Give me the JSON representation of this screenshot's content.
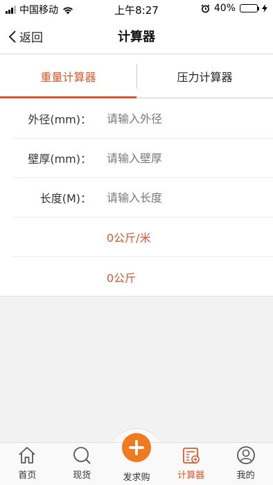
{
  "status_bar": {
    "carrier": "中国移动",
    "time": "上午8:27",
    "battery": "40%",
    "battery_level": 0.4,
    "battery_color": "#4cd964"
  },
  "nav": {
    "back_label": "返回",
    "title": "计算器",
    "back_icon": "chevron-left-icon"
  },
  "tabs": [
    {
      "label": "重量计算器",
      "active": true
    },
    {
      "label": "压力计算器",
      "active": false
    }
  ],
  "form": {
    "outer_diameter": {
      "label": "外径(mm)：",
      "placeholder": "请输入外径",
      "value": ""
    },
    "wall_thickness": {
      "label": "壁厚(mm)：",
      "placeholder": "请输入壁厚",
      "value": ""
    },
    "length": {
      "label": "长度(M)：",
      "placeholder": "请输入长度",
      "value": ""
    },
    "result_per_meter": "0公斤/米",
    "result_total": "0公斤"
  },
  "bottom_nav": {
    "items": [
      {
        "label": "首页",
        "icon": "home-icon",
        "active": false
      },
      {
        "label": "现货",
        "icon": "search-icon",
        "active": false
      },
      {
        "label": "发求购",
        "icon": "plus-icon",
        "active": false
      },
      {
        "label": "计算器",
        "icon": "calculator-icon",
        "active": true
      },
      {
        "label": "我的",
        "icon": "user-icon",
        "active": false
      }
    ]
  },
  "colors": {
    "accent": "#d9582b",
    "plus_button": "#f07a1e",
    "background": "#f2f2f2"
  }
}
